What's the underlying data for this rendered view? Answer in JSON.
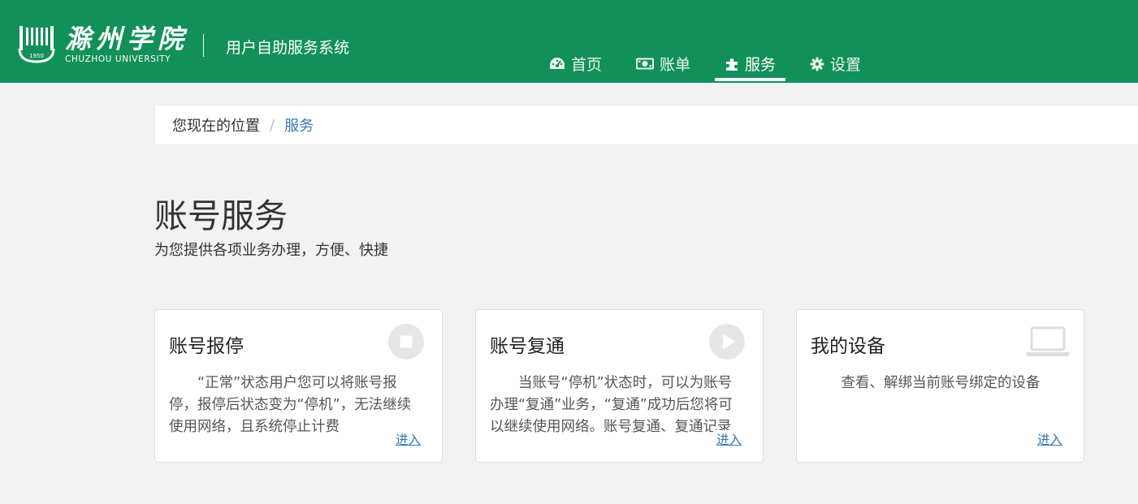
{
  "header": {
    "logo_cn": "滁州学院",
    "logo_en": "CHUZHOU UNIVERSITY",
    "logo_year": "1950",
    "system_title": "用户自助服务系统",
    "nav": [
      {
        "label": "首页",
        "icon": "dashboard-icon"
      },
      {
        "label": "账单",
        "icon": "money-icon"
      },
      {
        "label": "服务",
        "icon": "puzzle-icon",
        "active": true
      },
      {
        "label": "设置",
        "icon": "gear-icon"
      }
    ],
    "color": "#12905a"
  },
  "breadcrumb": {
    "label": "您现在的位置",
    "separator": "/",
    "current": "服务"
  },
  "page": {
    "title": "账号服务",
    "subtitle": "为您提供各项业务办理，方便、快捷"
  },
  "cards": [
    {
      "title": "账号报停",
      "icon": "stop-icon",
      "description": "“正常”状态用户您可以将账号报停，报停后状态变为“停机”，无法继续使用网络，且系统停止计费",
      "link": "进入"
    },
    {
      "title": "账号复通",
      "icon": "play-icon",
      "description": "当账号“停机”状态时，可以为账号办理“复通”业务，“复通”成功后您将可以继续使用网络。账号复通、复通记录",
      "link": "进入"
    },
    {
      "title": "我的设备",
      "icon": "laptop-icon",
      "description": "查看、解绑当前账号绑定的设备",
      "link": "进入"
    }
  ]
}
